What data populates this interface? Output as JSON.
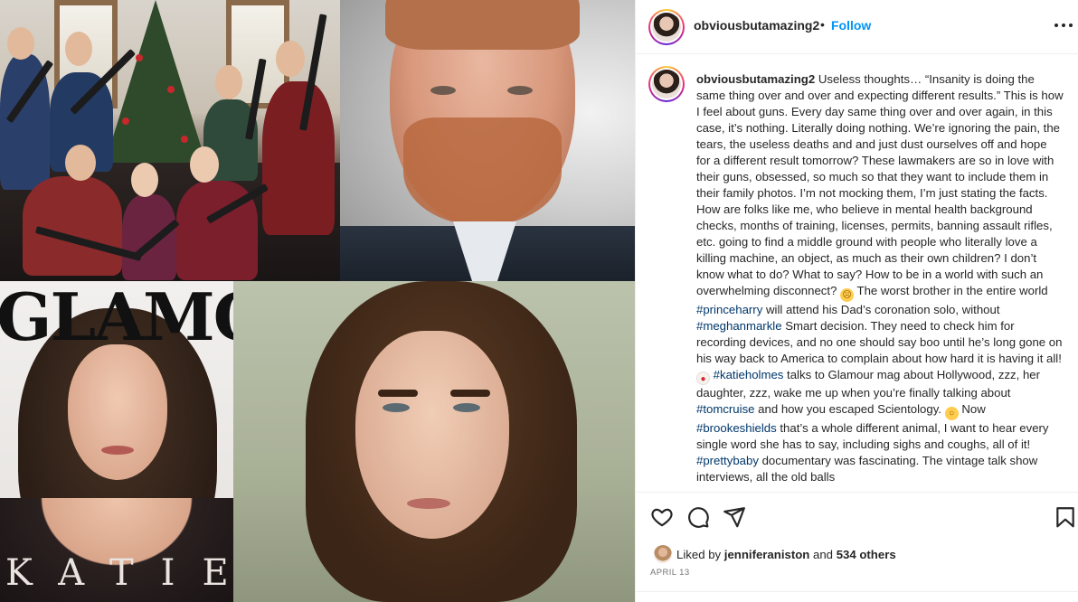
{
  "post": {
    "username": "obviousbutamazing2",
    "separator": "•",
    "follow_label": "Follow",
    "more_icon": "more-horizontal-icon"
  },
  "media": {
    "magazine_masthead": "GLAMOUR",
    "magazine_cover_name": "KATIE"
  },
  "caption": {
    "username": "obviousbutamazing2",
    "p1": "Useless thoughts… “Insanity is doing the same thing over and over and expecting different results.” This is how I feel about guns. Every day same thing over and over again, in this case, it’s nothing. Literally doing nothing. We’re ignoring the pain, the tears, the useless deaths and and just dust ourselves off and hope for a different result tomorrow? These lawmakers are so in love with their guns, obsessed, so much so that they want to include them in their family photos. I’m not mocking them, I’m just stating the facts. How are folks like me, who believe in mental health background checks, months of training, licenses, permits, banning assault rifles, etc. going to find a middle ground with people who literally love a killing machine, an object, as much as their own children? I don’t know what to do? What to say? How to be in a world with such an overwhelming disconnect?",
    "p2": "The worst brother in the entire world",
    "tag_princeharry": "#princeharry",
    "p3": "will attend his Dad’s coronation solo, without",
    "tag_meghanmarkle": "#meghanmarkle",
    "p4": "Smart decision. They need to check him for recording devices, and no one should say boo until he’s long gone on his way back to America to complain about how hard it is having it all!",
    "tag_katieholmes": "#katieholmes",
    "p5": "talks to Glamour mag about Hollywood, zzz, her daughter, zzz, wake me up when you’re finally talking about",
    "tag_tomcruise": "#tomcruise",
    "p6": "and how you escaped Scientology.",
    "p7": "Now",
    "tag_brookeshields": "#brookeshields",
    "p8": "that’s a whole different animal, I want to hear every single word she has to say, including sighs and coughs, all of it!",
    "tag_prettybaby": "#prettybaby",
    "p9": "documentary was fascinating. The vintage talk show interviews, all the old balls"
  },
  "emoji": {
    "pensive": "☹",
    "clown": "●",
    "astonished": "○"
  },
  "actions": {
    "like_icon": "heart-icon",
    "comment_icon": "comment-icon",
    "share_icon": "share-icon",
    "save_icon": "bookmark-icon"
  },
  "likes": {
    "prefix": "Liked by",
    "user": "jenniferaniston",
    "and": "and",
    "others": "534 others"
  },
  "date": "APRIL 13",
  "colors": {
    "link_blue": "#0095f6",
    "hashtag": "#00376b",
    "text": "#262626",
    "muted": "#737373"
  }
}
